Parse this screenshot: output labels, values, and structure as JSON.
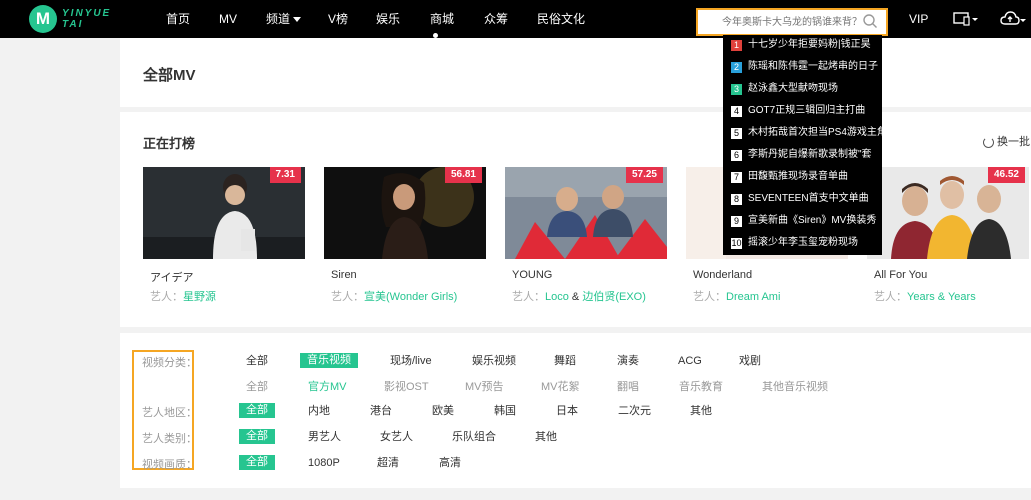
{
  "header": {
    "logo_letter": "M",
    "logo_line1": "YINYUE",
    "logo_line2": "TAI",
    "nav": [
      {
        "label": "首页"
      },
      {
        "label": "MV"
      },
      {
        "label": "频道"
      },
      {
        "label": "V榜"
      },
      {
        "label": "娱乐"
      },
      {
        "label": "商城"
      },
      {
        "label": "众筹"
      },
      {
        "label": "民俗文化"
      }
    ],
    "search_placeholder": "今年奥斯卡大乌龙的锅谁来背？",
    "vip_label": "VIP"
  },
  "dropdown": {
    "items": [
      {
        "num": "1",
        "text": "十七岁少年拒要妈粉|钱正昊"
      },
      {
        "num": "2",
        "text": "陈瑶和陈伟霆一起烤串的日子"
      },
      {
        "num": "3",
        "text": "赵泳鑫大型献吻现场"
      },
      {
        "num": "4",
        "text": "GOT7正规三辑回归主打曲"
      },
      {
        "num": "5",
        "text": "木村拓哉首次担当PS4游戏主角"
      },
      {
        "num": "6",
        "text": "李斯丹妮自爆新歌录制被\"套"
      },
      {
        "num": "7",
        "text": "田馥甄推现场录音单曲"
      },
      {
        "num": "8",
        "text": "SEVENTEEN首支中文单曲"
      },
      {
        "num": "9",
        "text": "宣美新曲《Siren》MV换装秀"
      },
      {
        "num": "10",
        "text": "摇滚少年李玉玺宠粉现场"
      }
    ]
  },
  "page": {
    "title": "全部MV",
    "chart_title": "正在打榜",
    "refresh_label": "换一批"
  },
  "cards": [
    {
      "score": "7.31",
      "title": "アイデア",
      "artist_prefix": "艺人：",
      "artists": [
        "星野源"
      ]
    },
    {
      "score": "56.81",
      "title": "Siren",
      "artist_prefix": "艺人：",
      "artists": [
        "宣美(Wonder Girls)"
      ]
    },
    {
      "score": "57.25",
      "title": "YOUNG",
      "artist_prefix": "艺人：",
      "artists": [
        "Loco",
        "边伯贤(EXO)"
      ],
      "joiner": "&"
    },
    {
      "score": "",
      "title": "Wonderland",
      "artist_prefix": "艺人：",
      "artists": [
        "Dream Ami"
      ]
    },
    {
      "score": "46.52",
      "title": "All For You",
      "artist_prefix": "艺人：",
      "artists": [
        "Years & Years"
      ]
    }
  ],
  "filters": {
    "video_type": {
      "label": "视频分类：",
      "options": [
        "全部",
        "音乐视频",
        "现场/live",
        "娱乐视频",
        "舞蹈",
        "演奏",
        "ACG",
        "戏剧"
      ],
      "selected": "音乐视频",
      "sub_options": [
        "全部",
        "官方MV",
        "影视OST",
        "MV预告",
        "MV花絮",
        "翻唱",
        "音乐教育",
        "其他音乐视频"
      ],
      "sub_selected": "官方MV"
    },
    "region": {
      "label": "艺人地区：",
      "options": [
        "全部",
        "内地",
        "港台",
        "欧美",
        "韩国",
        "日本",
        "二次元",
        "其他"
      ],
      "selected": "全部"
    },
    "artist_type": {
      "label": "艺人类别：",
      "options": [
        "全部",
        "男艺人",
        "女艺人",
        "乐队组合",
        "其他"
      ],
      "selected": "全部"
    },
    "quality": {
      "label": "视频画质：",
      "options": [
        "全部",
        "1080P",
        "超清",
        "高清"
      ],
      "selected": "全部"
    }
  },
  "colors": {
    "accent": "#26c590",
    "score_badge": "#e6324b",
    "highlight_border": "#f5a623",
    "header_bg": "#000000"
  }
}
